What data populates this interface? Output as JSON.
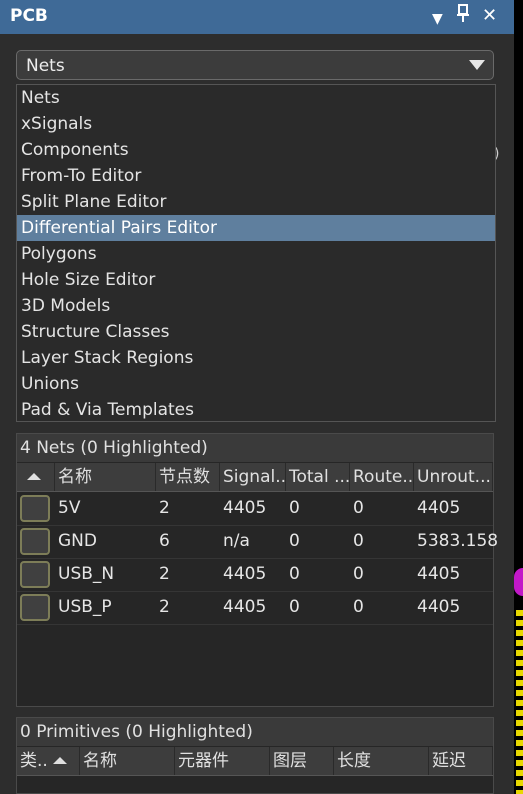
{
  "titlebar": {
    "title": "PCB",
    "dropdown_icon": "▼",
    "pin_icon": "⊥",
    "close_icon": "✕"
  },
  "combo": {
    "value": "Nets"
  },
  "dropdown": {
    "items": [
      "Nets",
      "xSignals",
      "Components",
      "From-To Editor",
      "Split Plane Editor",
      "Differential Pairs Editor",
      "Polygons",
      "Hole Size Editor",
      "3D Models",
      "Structure Classes",
      "Layer Stack Regions",
      "Unions",
      "Pad & Via Templates"
    ],
    "selected_index": 5
  },
  "behind_text": ")",
  "nets": {
    "header": "4 Nets (0 Highlighted)",
    "columns": [
      "名称",
      "节点数",
      "Signal...",
      "Total ...",
      "Route...",
      "Unrout..."
    ],
    "rows": [
      {
        "name": "5V",
        "nodes": "2",
        "signal": "4405",
        "total": "0",
        "routed": "0",
        "unrouted": "4405"
      },
      {
        "name": "GND",
        "nodes": "6",
        "signal": "n/a",
        "total": "0",
        "routed": "0",
        "unrouted": "5383.158"
      },
      {
        "name": "USB_N",
        "nodes": "2",
        "signal": "4405",
        "total": "0",
        "routed": "0",
        "unrouted": "4405"
      },
      {
        "name": "USB_P",
        "nodes": "2",
        "signal": "4405",
        "total": "0",
        "routed": "0",
        "unrouted": "4405"
      }
    ]
  },
  "primitives": {
    "header": "0 Primitives (0 Highlighted)",
    "columns": [
      "类..",
      "名称",
      "元器件",
      "图层",
      "长度",
      "延迟"
    ]
  },
  "colors": {
    "titlebar": "#3f6a97",
    "selection": "#5f7f9e",
    "panel": "#2d2d2d"
  }
}
